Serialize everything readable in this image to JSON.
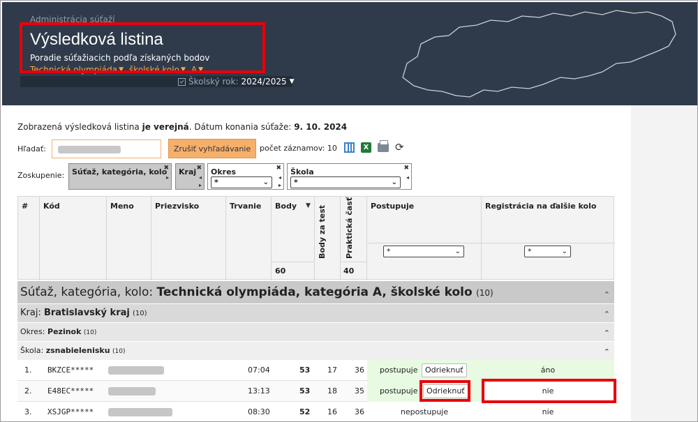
{
  "header": {
    "admin_link": "Administrácia súťaží",
    "title": "Výsledková listina",
    "subtitle": "Poradie súťažiacich podľa získaných bodov",
    "competition": "Technická olympiáda",
    "round": "školské kolo",
    "category": "A",
    "school_year_label": "Školský rok:",
    "school_year_value": "2024/2025"
  },
  "info": {
    "prefix": "Zobrazená výsledková listina ",
    "public": "je verejná",
    "middle": ". Dátum konania súťaže: ",
    "date": "9. 10. 2024"
  },
  "search": {
    "label": "Hľadať:",
    "clear_button": "Zrušiť vyhľadávanie",
    "count_label": "počet záznamov: 10"
  },
  "grouping": {
    "label": "Zoskupenie:",
    "chips": [
      "Súťaž, kategória, kolo",
      "Kraj",
      "Okres",
      "Škola"
    ],
    "okres_filter": "*",
    "skola_filter": "*"
  },
  "table": {
    "headers": {
      "num": "#",
      "code": "Kód",
      "name": "Meno",
      "surname": "Priezvisko",
      "duration": "Trvanie",
      "points": "Body",
      "test_points": "Body za test",
      "practical": "Praktická časť",
      "advances": "Postupuje",
      "registration": "Registrácia na ďalšie kolo"
    },
    "points_max": "60",
    "practical_max": "40",
    "advances_filter": "*",
    "registration_filter": "*"
  },
  "groups": {
    "competition_label": "Súťaž, kategória, kolo: ",
    "competition_value": "Technická olympiáda, kategória A, školské kolo",
    "competition_count": "(10)",
    "region_label": "Kraj: ",
    "region_value": "Bratislavský kraj",
    "region_count": "(10)",
    "district_label": "Okres: ",
    "district_value": "Pezinok",
    "district_count": "(10)",
    "school_label": "Škola: ",
    "school_value": "zsnabielenisku",
    "school_count": "(10)"
  },
  "rows": [
    {
      "num": "1.",
      "code": "BKZCE*****",
      "duration": "07:04",
      "points": "53",
      "test": "17",
      "practical": "36",
      "advances": "postupuje",
      "action": "Odrieknuť",
      "registration": "áno"
    },
    {
      "num": "2.",
      "code": "E48EC*****",
      "duration": "13:13",
      "points": "53",
      "test": "18",
      "practical": "35",
      "advances": "postupuje",
      "action": "Odrieknuť",
      "registration": "nie"
    },
    {
      "num": "3.",
      "code": "XSJGP*****",
      "duration": "08:30",
      "points": "52",
      "test": "16",
      "practical": "36",
      "advances": "nepostupuje",
      "action": "",
      "registration": "nie"
    }
  ]
}
